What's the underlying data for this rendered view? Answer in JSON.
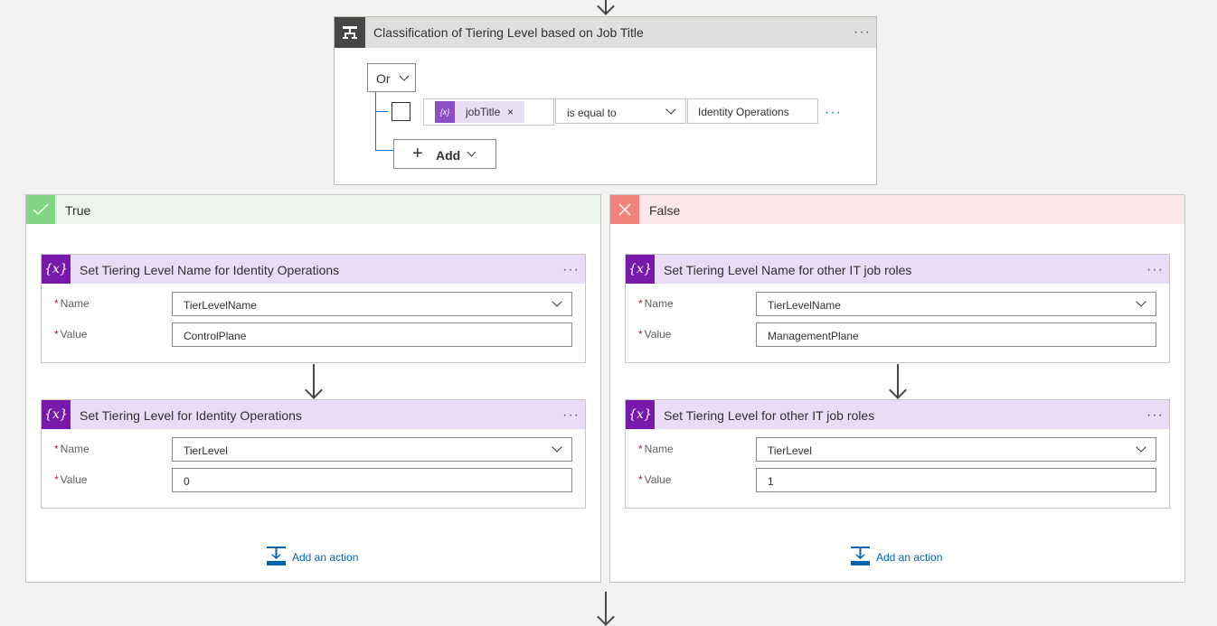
{
  "condition": {
    "title": "Classification of Tiering Level based on Job Title",
    "group_operator": "Or",
    "row": {
      "token_label": "jobTitle",
      "token_remove": "×",
      "operator": "is equal to",
      "value": "Identity Operations"
    },
    "add_label": "Add",
    "more": "···"
  },
  "branches": {
    "true": {
      "title": "True",
      "card1": {
        "title": "Set Tiering Level Name for Identity Operations",
        "name_label": "Name",
        "name_value": "TierLevelName",
        "value_label": "Value",
        "value_value": "ControlPlane"
      },
      "card2": {
        "title": "Set Tiering Level for Identity Operations",
        "name_label": "Name",
        "name_value": "TierLevel",
        "value_label": "Value",
        "value_value": "0"
      },
      "add_action": "Add an action"
    },
    "false": {
      "title": "False",
      "card1": {
        "title": "Set Tiering Level Name for other IT job roles",
        "name_label": "Name",
        "name_value": "TierLevelName",
        "value_label": "Value",
        "value_value": "ManagementPlane"
      },
      "card2": {
        "title": "Set Tiering Level for other IT job roles",
        "name_label": "Name",
        "name_value": "TierLevel",
        "value_label": "Value",
        "value_value": "1"
      },
      "add_action": "Add an action"
    }
  },
  "required_mark": "*",
  "variable_icon_glyph": "{x}",
  "token_icon_glyph": "{x}",
  "colors": {
    "accent": "#0078d4",
    "variable_purple": "#7719aa",
    "true_green": "#7fd683",
    "false_red": "#f1827c"
  }
}
